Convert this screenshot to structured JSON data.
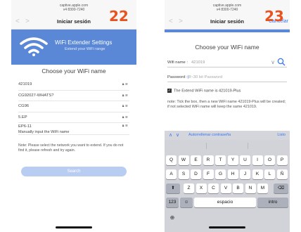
{
  "screen1": {
    "url_line1": "captive.apple.com",
    "url_line2": "v4 8300-7240",
    "title": "Iniciar sesión",
    "step": "22",
    "hero_title": "WiFi Extender Settings",
    "hero_subtitle": "Extend your WiFi range",
    "choose_title": "Choose your WiFi name",
    "networks": [
      {
        "name": "421019"
      },
      {
        "name": "CG92027-WHATS?"
      },
      {
        "name": "CG96"
      },
      {
        "name": "5.EP"
      },
      {
        "name": "EP6-11"
      }
    ],
    "manual_label": "Manually input the WiFi name",
    "note": "Note: Please select the network you want to extend. If you do not find it, please refresh and try again.",
    "search_button": "Search",
    "colors": {
      "accent": "#5a87d6",
      "step": "#e8521e"
    }
  },
  "screen2": {
    "url_line1": "captive.apple.com",
    "url_line2": "v4 8300-7240",
    "title": "Iniciar sesión",
    "step": "23",
    "cancel": "Cancelar",
    "choose_title": "Choose your WiFi name",
    "wifi_label": "Wifi name :",
    "wifi_value": "421019",
    "password_label": "Password :",
    "password_placeholder": "8~30 bit Password",
    "checkbox_text": "The Extend WiFi name is 421019-Plus",
    "note": "note: Tick the box, then a new WiFi name 421019-Plus will be created; if not selected WiFi name will keep the same 421019.",
    "accessory": {
      "autofill": "Autorrellenar contraseña",
      "done": "Listo"
    },
    "keyboard": {
      "row1": [
        "Q",
        "W",
        "E",
        "R",
        "T",
        "Y",
        "U",
        "I",
        "O",
        "P"
      ],
      "row2": [
        "A",
        "S",
        "D",
        "F",
        "G",
        "H",
        "J",
        "K",
        "L",
        "Ñ"
      ],
      "row3": [
        "Z",
        "X",
        "C",
        "V",
        "B",
        "N",
        "M"
      ],
      "shift": "⬆",
      "delete": "⌫",
      "numbers": "123",
      "emoji": "☺",
      "space": "espacio",
      "intro": "intro",
      "globe": "⊕"
    }
  }
}
